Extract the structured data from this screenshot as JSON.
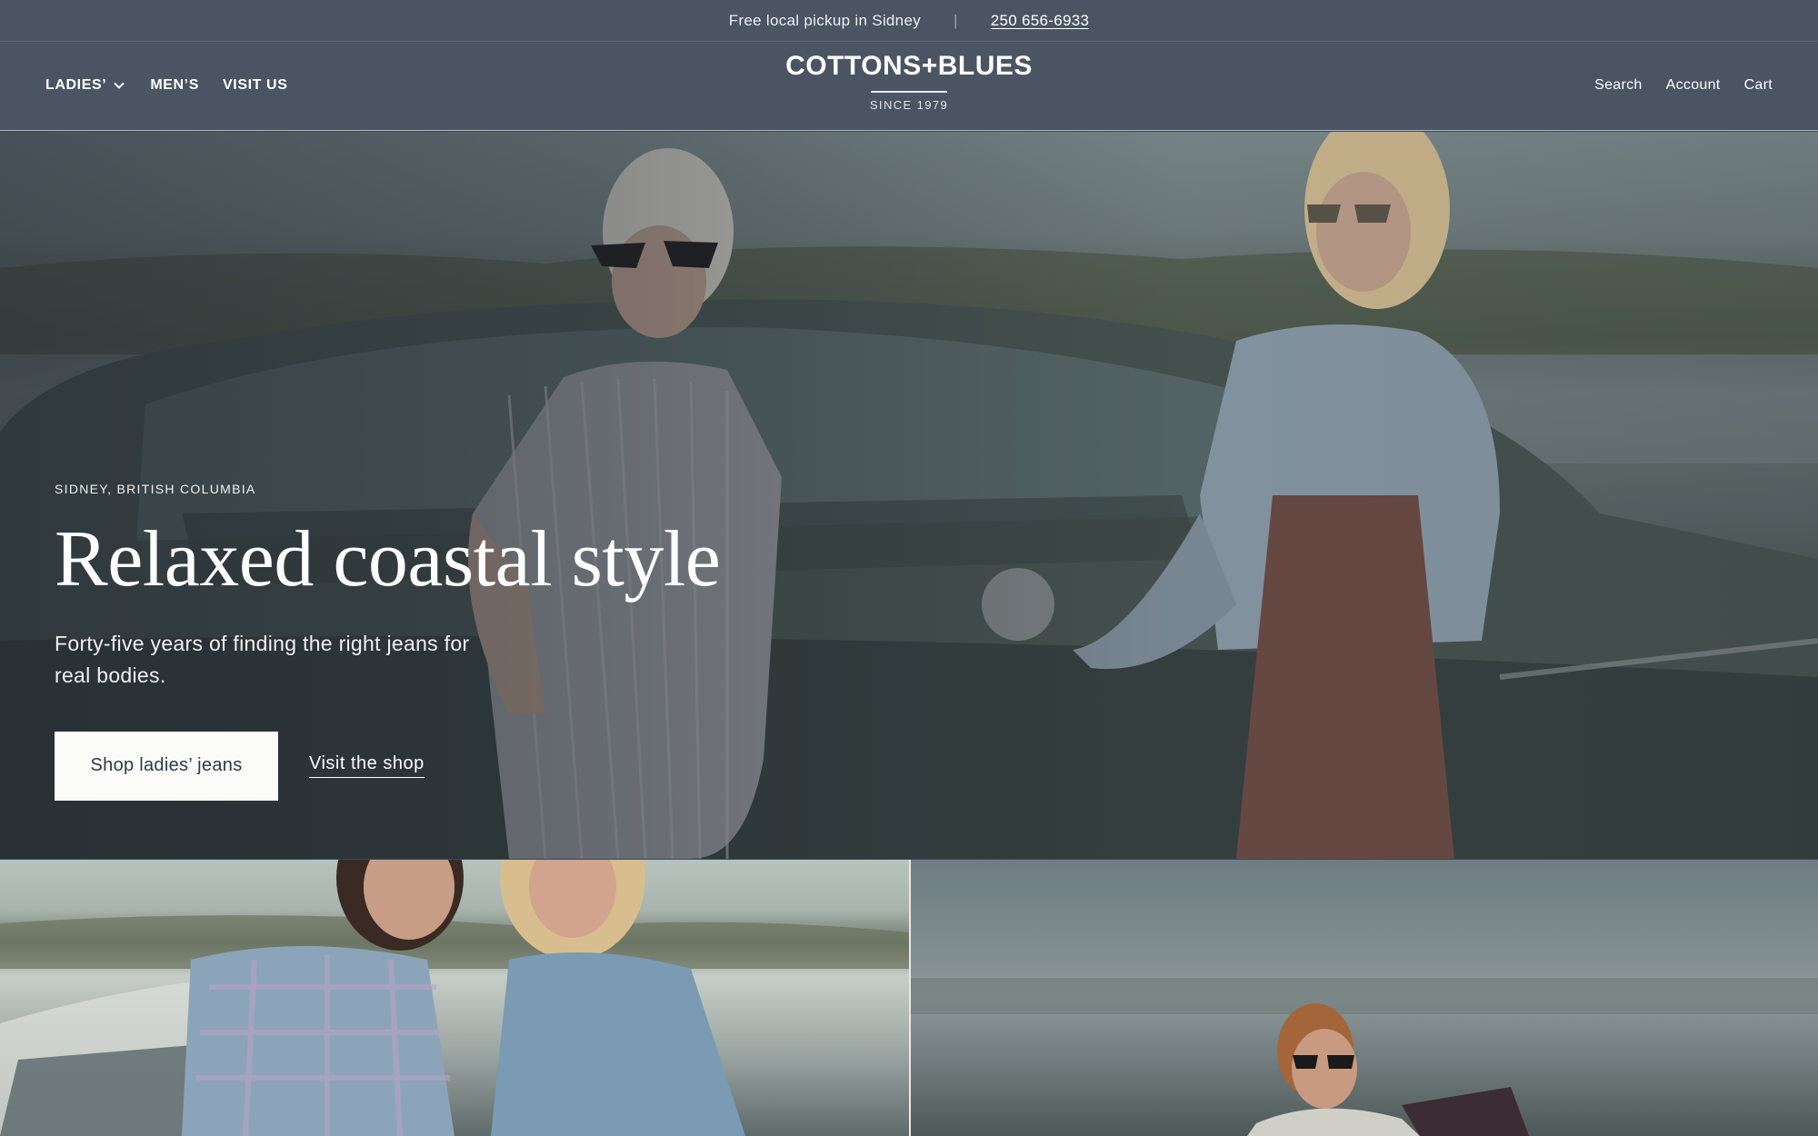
{
  "announcement": {
    "pickup_text": "Free local pickup in Sidney",
    "separator": "|",
    "phone": "250 656-6933"
  },
  "header": {
    "nav_left": [
      {
        "label": "LADIES’",
        "has_dropdown": true
      },
      {
        "label": "MEN’S"
      },
      {
        "label": "VISIT US"
      }
    ],
    "logo": {
      "name": "COTTONS+BLUES",
      "tagline": "SINCE 1979"
    },
    "nav_right": [
      {
        "label": "Search"
      },
      {
        "label": "Account"
      },
      {
        "label": "Cart"
      }
    ],
    "icons": {
      "dropdown": "chevron-down-icon"
    }
  },
  "hero": {
    "eyebrow": "SIDNEY, BRITISH COLUMBIA",
    "title": "Relaxed coastal style",
    "subtitle": "Forty-five years of finding the right jeans for real bodies.",
    "primary_cta": "Shop ladies’ jeans",
    "secondary_cta": "Visit the shop"
  },
  "colors": {
    "header_bg": "#4a5462",
    "button_bg": "#fbfbf8",
    "button_text": "#2f3945"
  }
}
